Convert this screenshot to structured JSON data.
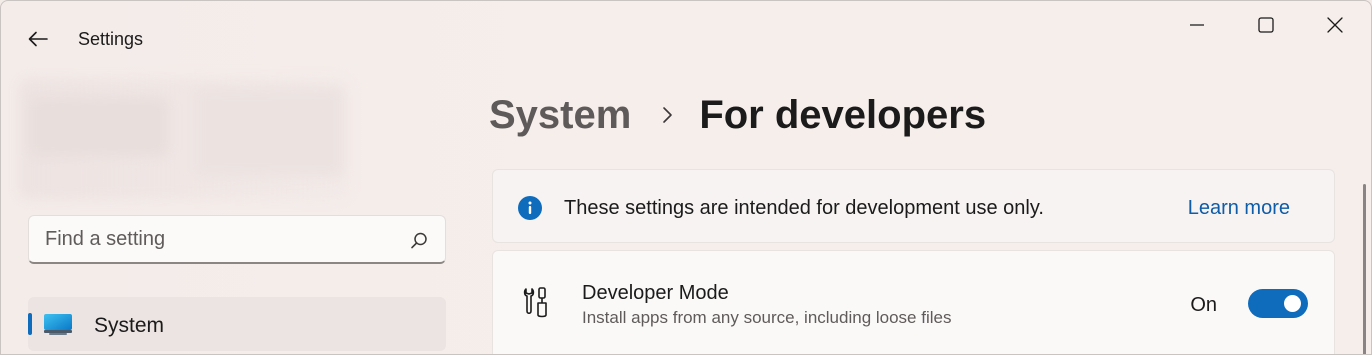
{
  "window": {
    "title": "Settings",
    "accent_color": "#0f6cbd"
  },
  "titlebar": {
    "back_icon": "arrow-left-icon",
    "minimize_icon": "minimize-icon",
    "maximize_icon": "maximize-icon",
    "close_icon": "close-icon"
  },
  "sidebar": {
    "search": {
      "placeholder": "Find a setting",
      "value": "",
      "icon": "search-icon"
    },
    "items": [
      {
        "label": "System",
        "icon": "monitor-icon",
        "selected": true
      }
    ]
  },
  "main": {
    "breadcrumb": {
      "parent": "System",
      "separator_icon": "chevron-right-icon",
      "current": "For developers"
    },
    "info_banner": {
      "icon": "info-icon",
      "text": "These settings are intended for development use only.",
      "link": "Learn more"
    },
    "developer_mode": {
      "icon": "tools-icon",
      "title": "Developer Mode",
      "description": "Install apps from any source, including loose files",
      "state_label": "On",
      "enabled": true
    }
  }
}
